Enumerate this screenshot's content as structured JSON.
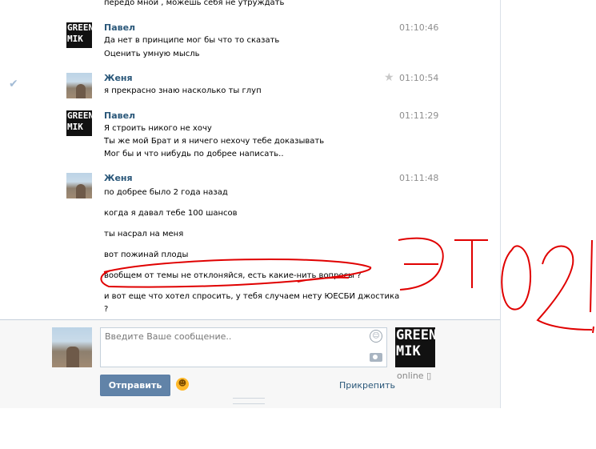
{
  "messages_top_fragment": "передо мной , можешь себя не утруждать",
  "messages": [
    {
      "author": "Павел",
      "time": "01:10:46",
      "lines": [
        "Да нет в принципе мог бы что то сказать",
        "Оценить умную мысль"
      ]
    },
    {
      "author": "Женя",
      "time": "01:10:54",
      "lines": [
        "я прекрасно знаю насколько ты глуп"
      ]
    },
    {
      "author": "Павел",
      "time": "01:11:29",
      "lines": [
        "Я строить никого не хочу",
        "Ты же мой Брат и я ничего нехочу тебе доказывать",
        "Мог бы и что нибудь по добрее написать.."
      ]
    },
    {
      "author": "Женя",
      "time": "01:11:48",
      "lines": [
        "по добрее было 2 года назад",
        "когда я давал тебе 100 шансов",
        "ты насрал на меня",
        "вот пожинай плоды",
        "вообщем от темы не отклоняйся, есть какие-нить вопросы ?",
        "и вот еще что хотел спросить, у тебя случаем нету ЮЕСБИ джостика",
        "?"
      ]
    }
  ],
  "composer": {
    "placeholder": "Введите Ваше сообщение..",
    "send_label": "Отправить",
    "attach_label": "Прикрепить"
  },
  "friend": {
    "avatar_text": "GREEN MIK",
    "status": "online"
  },
  "icons": {
    "read": "checkmark-icon",
    "star": "star-icon",
    "emoji": "smiley-icon",
    "camera": "camera-icon",
    "phone": "mobile-icon"
  },
  "colors": {
    "author": "#2b587a",
    "send_button": "#6183a8",
    "annotation": "#e00000"
  }
}
